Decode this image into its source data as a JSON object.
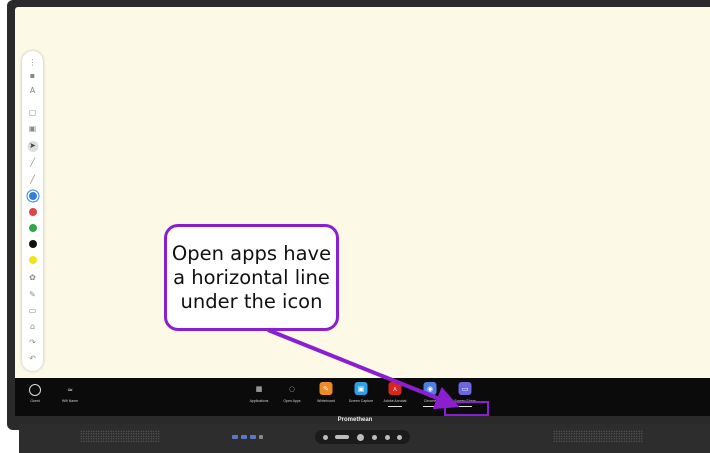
{
  "callout": {
    "lines": [
      "Open apps have",
      "a horizontal line",
      "under the icon"
    ],
    "color": "#8b1fcf"
  },
  "toolbar": {
    "items": [
      {
        "icon": "more-icon"
      },
      {
        "icon": "save-icon"
      },
      {
        "icon": "text-size-icon"
      },
      {
        "icon": "page-icon"
      },
      {
        "icon": "pages-icon"
      },
      {
        "icon": "select-icon"
      },
      {
        "icon": "pen-icon"
      },
      {
        "icon": "marker-icon"
      },
      {
        "icon": "color-blue",
        "color": "#2f7fe0"
      },
      {
        "icon": "color-red",
        "color": "#e04545"
      },
      {
        "icon": "color-green",
        "color": "#2fa84a"
      },
      {
        "icon": "color-black",
        "color": "#111111"
      },
      {
        "icon": "color-yellow",
        "color": "#f2e21a"
      },
      {
        "icon": "palette-icon"
      },
      {
        "icon": "highlighter-icon"
      },
      {
        "icon": "eraser-icon"
      },
      {
        "icon": "tools-icon"
      },
      {
        "icon": "redo-icon"
      },
      {
        "icon": "undo-icon"
      }
    ]
  },
  "taskbar": {
    "left": [
      {
        "label": "Guest",
        "icon": "user-icon"
      },
      {
        "label": "Wifi Name",
        "icon": "wifi-icon"
      }
    ],
    "apps": [
      {
        "label": "Applications",
        "icon": "grid-icon",
        "color": "#0b0b0b",
        "open": false
      },
      {
        "label": "Open Apps",
        "icon": "open-apps-icon",
        "color": "#0b0b0b",
        "open": false
      },
      {
        "label": "Whiteboard",
        "icon": "whiteboard-app-icon",
        "color": "#f08a24",
        "open": false
      },
      {
        "label": "Screen Capture",
        "icon": "screen-capture-app-icon",
        "color": "#2fa0e8",
        "open": false
      },
      {
        "label": "Adobe Acrobat",
        "icon": "acrobat-app-icon",
        "color": "#d9261c",
        "open": true
      },
      {
        "label": "Chrome",
        "icon": "browser-app-icon",
        "color": "#4d7ee8",
        "open": true
      },
      {
        "label": "Screen Share",
        "icon": "screen-share-app-icon",
        "color": "#6a67e0",
        "open": true
      }
    ]
  },
  "bezel": {
    "brand": "Promethean"
  }
}
